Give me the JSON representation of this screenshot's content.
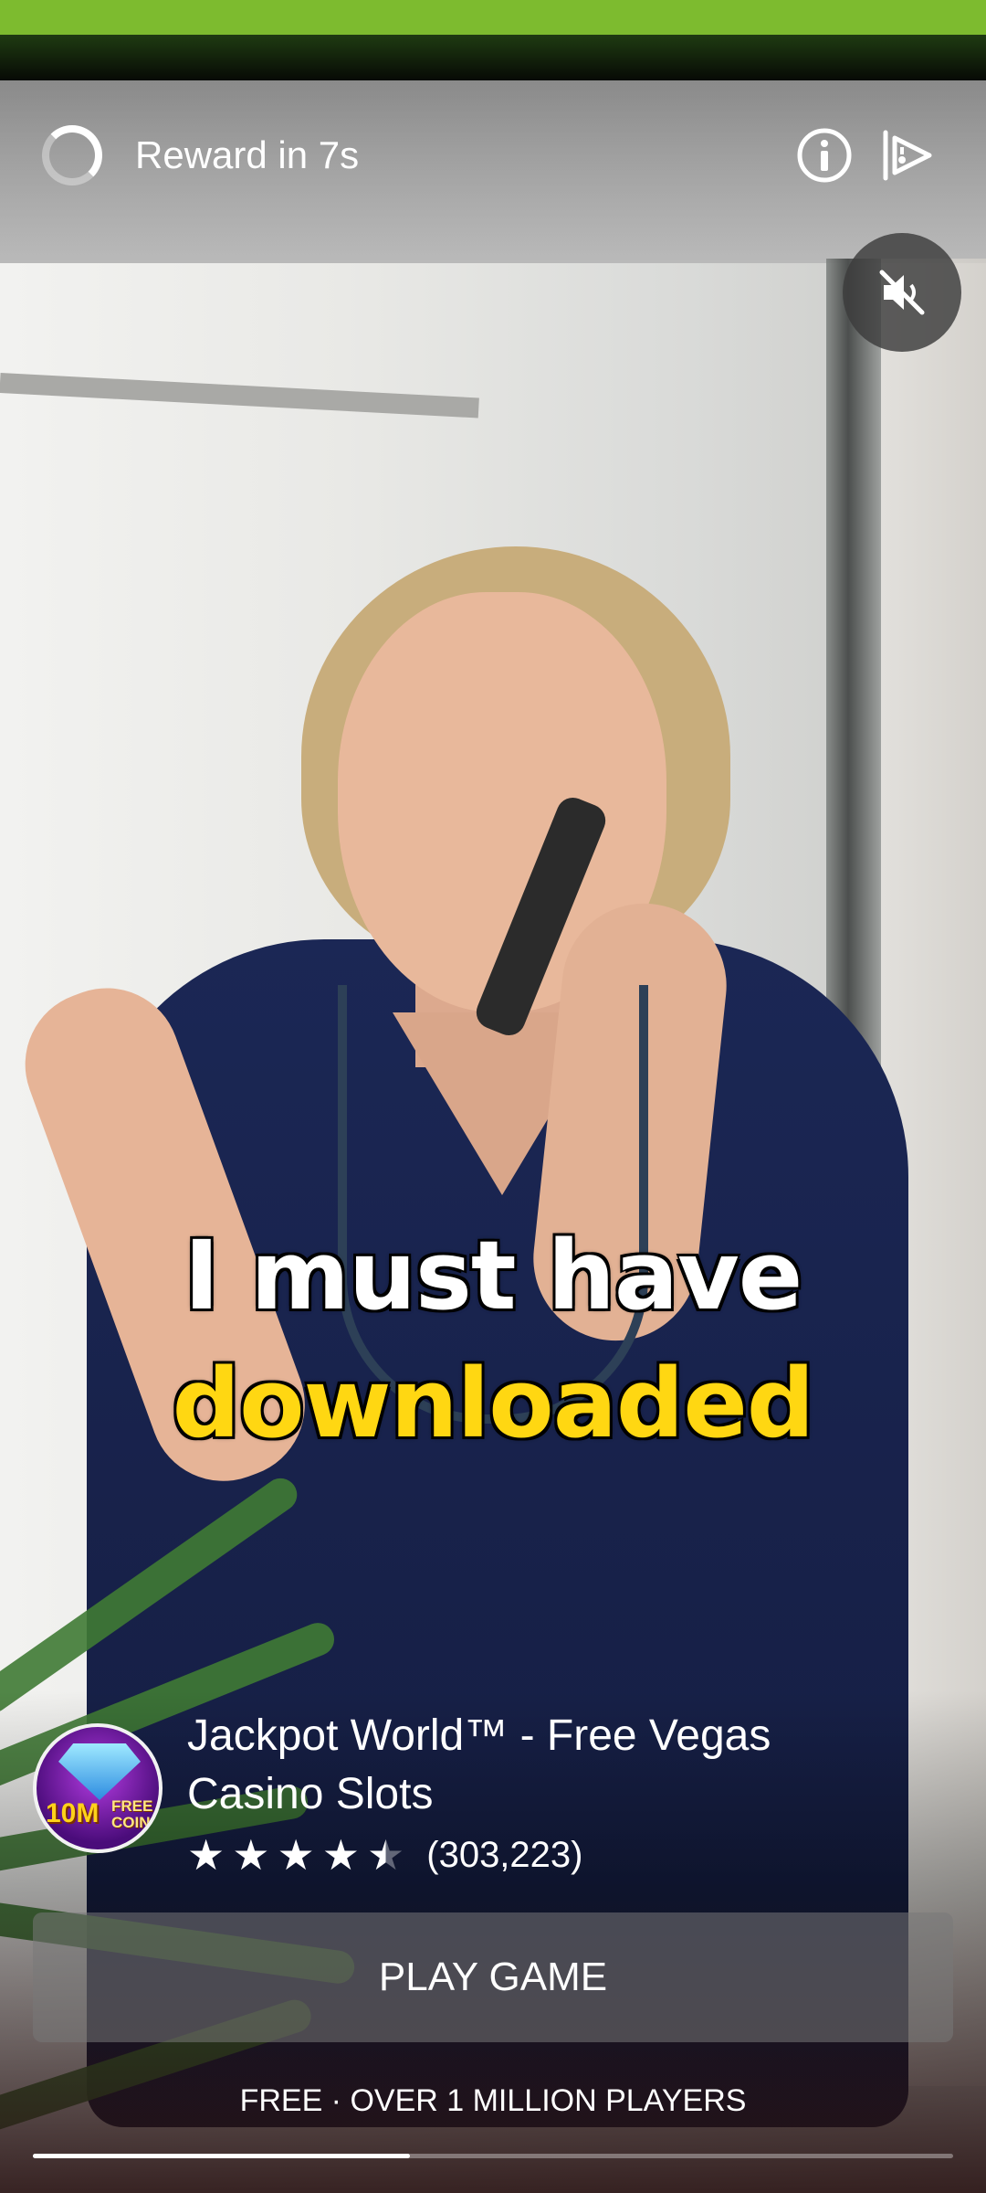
{
  "status_bar": {
    "color": "#7dbb2f"
  },
  "reward": {
    "text": "Reward in 7s",
    "icon": "loading-spinner-icon"
  },
  "top_actions": [
    {
      "name": "info-icon"
    },
    {
      "name": "ad-choices-icon"
    }
  ],
  "mute_button": {
    "icon": "speaker-muted-icon"
  },
  "subtitles": {
    "line1": "I must have",
    "line2": "downloaded",
    "line2_color": "#ffd712"
  },
  "app": {
    "title": "Jackpot World™ - Free Vegas Casino Slots",
    "icon_badge": {
      "big": "10M",
      "small_line1": "FREE",
      "small_line2": "COINS"
    },
    "rating": 4.5,
    "review_count": "(303,223)"
  },
  "cta": {
    "label": "PLAY GAME"
  },
  "tagline": "FREE · OVER 1 MILLION PLAYERS",
  "progress": {
    "fraction": 0.41
  }
}
